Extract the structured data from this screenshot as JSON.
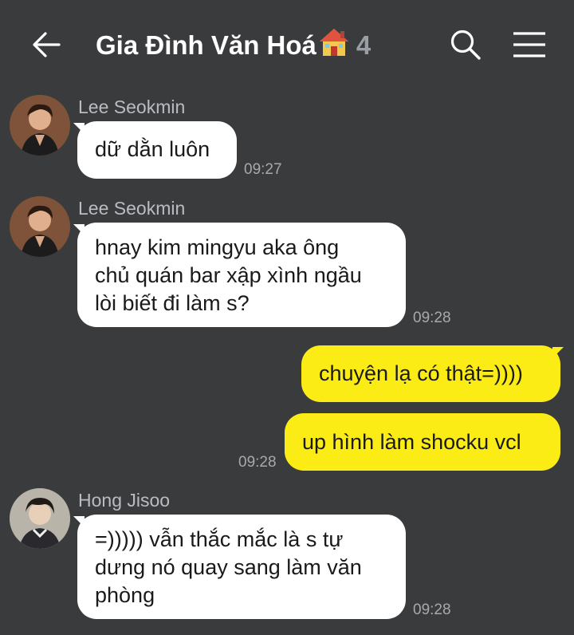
{
  "header": {
    "title": "Gia Đình Văn Hoá",
    "member_count": "4",
    "back_icon": "arrow-left-icon",
    "search_icon": "search-icon",
    "menu_icon": "hamburger-menu-icon"
  },
  "colors": {
    "background": "#3a3b3c",
    "incoming_bubble": "#ffffff",
    "outgoing_bubble": "#fcec16",
    "sender_name": "#b9bcc2",
    "timestamp": "#a6a9ae"
  },
  "messages": [
    {
      "sender": "Lee Seokmin",
      "direction": "incoming",
      "lines": [
        "dữ dằn luôn"
      ],
      "time": "09:27"
    },
    {
      "sender": "Lee Seokmin",
      "direction": "incoming",
      "lines": [
        "hnay kim mingyu aka ông",
        "chủ quán bar xập xình ngầu",
        "lòi biết đi làm s?"
      ],
      "time": "09:28"
    },
    {
      "direction": "outgoing",
      "lines": [
        "chuyện lạ có thật=))))"
      ],
      "time": ""
    },
    {
      "direction": "outgoing",
      "lines": [
        "up hình làm shocku vcl"
      ],
      "time": "09:28"
    },
    {
      "sender": "Hong Jisoo",
      "direction": "incoming",
      "lines": [
        "=))))) vẫn thắc mắc là s tự",
        "dưng nó quay sang làm văn",
        "phòng"
      ],
      "time": "09:28"
    }
  ]
}
